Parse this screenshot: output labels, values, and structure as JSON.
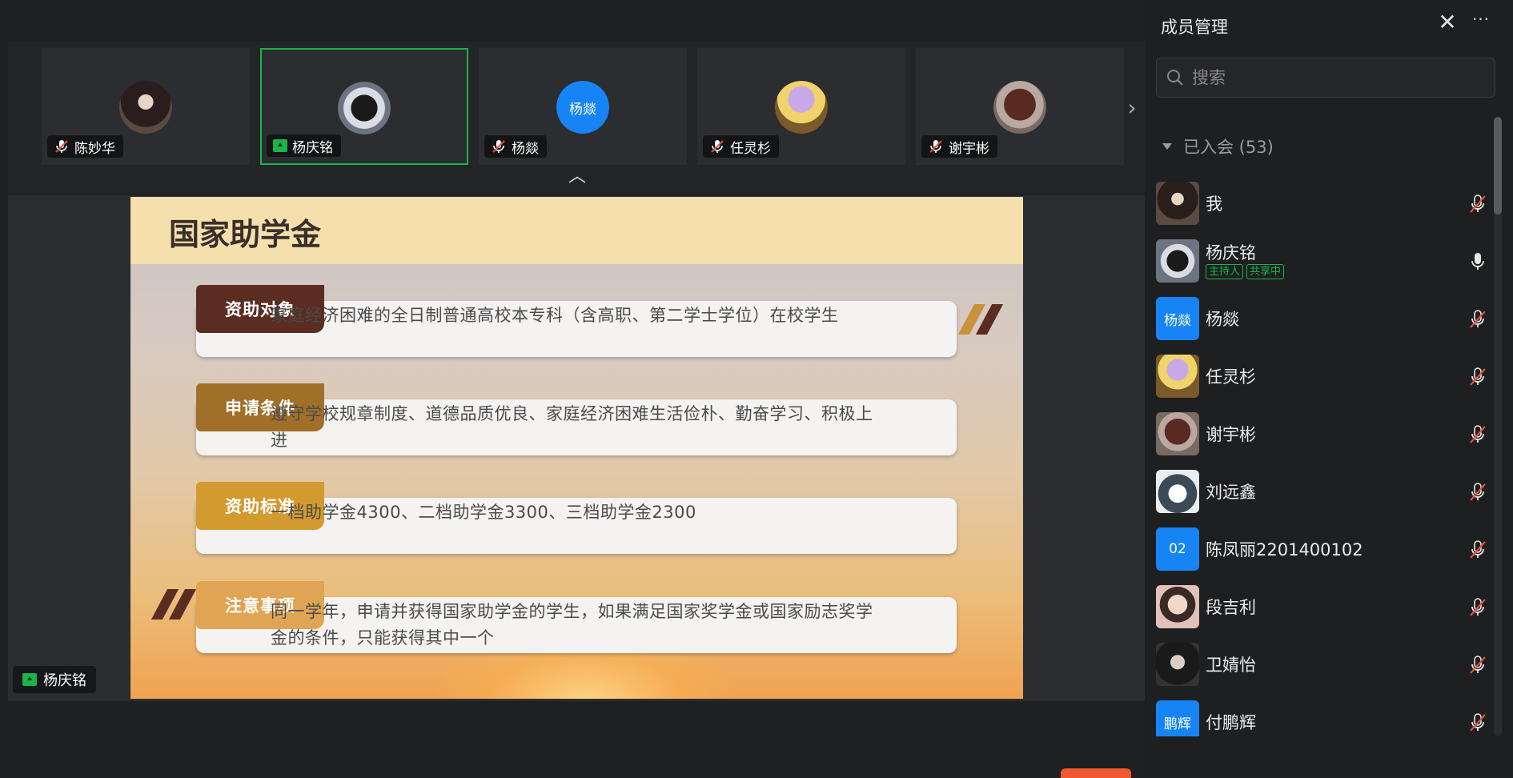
{
  "thumbnails": [
    {
      "name": "陈妙华",
      "status": "muted",
      "avatar": "photo-woman"
    },
    {
      "name": "杨庆铭",
      "status": "sharing",
      "avatar": "photo-cat",
      "active": true
    },
    {
      "name": "杨燚",
      "status": "muted",
      "avatar": "text",
      "avatar_text": "杨燚"
    },
    {
      "name": "任灵杉",
      "status": "muted",
      "avatar": "photo-cartoon"
    },
    {
      "name": "谢宇彬",
      "status": "muted",
      "avatar": "photo-house"
    }
  ],
  "slide": {
    "title": "国家助学金",
    "rows": [
      {
        "label": "资助对象",
        "text": "家庭经济困难的全日制普通高校本专科（含高职、第二学士学位）在校学生",
        "color": "#5b2c22"
      },
      {
        "label": "申请条件",
        "text": "遵守学校规章制度、道德品质优良、家庭经济困难生活俭朴、勤奋学习、积极上进",
        "color": "#a0702a"
      },
      {
        "label": "资助标准",
        "text": "一档助学金4300、二档助学金3300、三档助学金2300",
        "color": "#d39a30"
      },
      {
        "label": "注意事项",
        "text": "同一学年，申请并获得国家助学金的学生，如果满足国家奖学金或国家励志奖学金的条件，只能获得其中一个",
        "color": "#e0a455"
      }
    ]
  },
  "sharer": {
    "name": "杨庆铭"
  },
  "panel": {
    "title": "成员管理",
    "search_placeholder": "搜索",
    "group_label": "已入会 (53)",
    "members": [
      {
        "name": "我",
        "avatar": "photo-woman",
        "mic": "muted"
      },
      {
        "name": "杨庆铭",
        "avatar": "photo-cat",
        "mic": "on",
        "badges": [
          "主持人",
          "共享中"
        ]
      },
      {
        "name": "杨燚",
        "avatar": "text",
        "avatar_text": "杨燚",
        "mic": "muted"
      },
      {
        "name": "任灵杉",
        "avatar": "photo-cartoon",
        "mic": "muted"
      },
      {
        "name": "谢宇彬",
        "avatar": "photo-house",
        "mic": "muted"
      },
      {
        "name": "刘远鑫",
        "avatar": "photo-wolf",
        "mic": "muted"
      },
      {
        "name": "陈凤丽2201400102",
        "avatar": "text",
        "avatar_text": "02",
        "mic": "muted"
      },
      {
        "name": "段吉利",
        "avatar": "photo-girl",
        "mic": "muted"
      },
      {
        "name": "卫婧怡",
        "avatar": "photo-dark",
        "mic": "muted"
      },
      {
        "name": "付鹏辉",
        "avatar": "text",
        "avatar_text": "鹏辉",
        "mic": "muted"
      }
    ]
  },
  "colors": {
    "accent_green": "#1bb34a",
    "avatar_blue": "#1784f5",
    "muted_red": "#e2513a",
    "end_button": "#f0592f"
  }
}
